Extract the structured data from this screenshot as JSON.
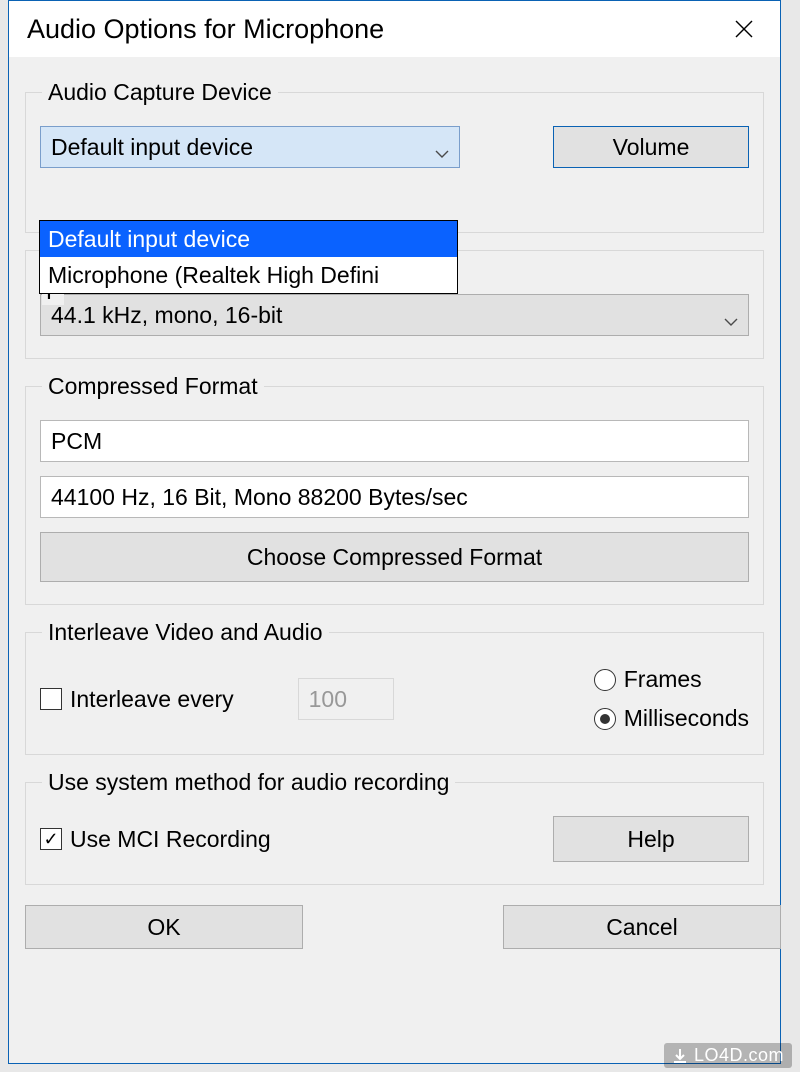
{
  "window": {
    "title": "Audio Options for Microphone"
  },
  "capture": {
    "legend": "Audio Capture Device",
    "selected": "Default input device",
    "options": [
      "Default input device",
      "Microphone (Realtek High Defini"
    ],
    "volume_btn": "Volume"
  },
  "recording_format": {
    "legend_first_char": "F",
    "selected": "44.1 kHz, mono, 16-bit"
  },
  "compressed": {
    "legend": "Compressed Format",
    "codec": "PCM",
    "detail": "44100 Hz, 16 Bit, Mono 88200 Bytes/sec",
    "choose_btn": "Choose  Compressed Format"
  },
  "interleave": {
    "legend": "Interleave Video and Audio",
    "check_label": "Interleave every",
    "checked": false,
    "value": "100",
    "radio_frames": "Frames",
    "radio_ms": "Milliseconds",
    "radio_selected": "Milliseconds"
  },
  "system_method": {
    "legend": "Use system method for audio recording",
    "check_label": "Use MCI Recording",
    "checked": true,
    "help_btn": "Help"
  },
  "footer": {
    "ok": "OK",
    "cancel": "Cancel"
  },
  "watermark": "LO4D.com"
}
